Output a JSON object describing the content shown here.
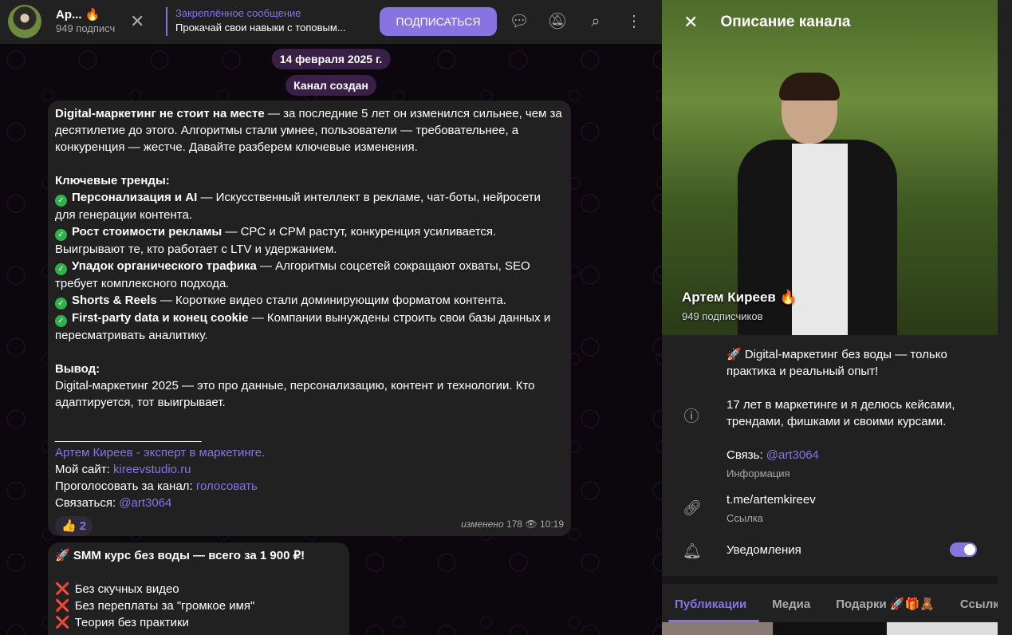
{
  "header": {
    "name": "Ар...",
    "name_emoji": "🔥",
    "subscribers": "949 подписч",
    "pinned_title": "Закреплённое сообщение",
    "pinned_text": "Прокачай свои навыки с топовым...",
    "subscribe": "ПОДПИСАТЬСЯ"
  },
  "chat": {
    "date": "14 февраля 2025 г.",
    "service": "Канал создан",
    "msg1": {
      "p1_bold": "Digital-маркетинг не стоит на месте",
      "p1": " — за последние 5 лет он изменился сильнее, чем за десятилетие до этого. Алгоритмы стали умнее, пользователи — требовательнее, а конкуренция — жестче. Давайте разберем ключевые изменения.",
      "trends_title": "Ключевые тренды:",
      "trends": [
        {
          "b": "Персонализация и AI",
          "t": " — Искусственный интеллект в рекламе, чат-боты, нейросети для генерации контента."
        },
        {
          "b": "Рост стоимости рекламы",
          "t": " — CPC и CPM растут, конкуренция усиливается. Выигрывают те, кто работает с LTV и удержанием."
        },
        {
          "b": "Упадок органического трафика",
          "t": " — Алгоритмы соцсетей сокращают охваты, SEO требует комплексного подхода."
        },
        {
          "b": "Shorts & Reels",
          "t": " — Короткие видео стали доминирующим форматом контента."
        },
        {
          "b": "First-party data и конец cookie",
          "t": " — Компании вынуждены строить свои базы данных и пересматривать аналитику."
        }
      ],
      "conclusion_title": "Вывод:",
      "conclusion": "Digital-маркетинг 2025 — это про данные, персонализацию, контент и технологии. Кто адаптируется, тот выигрывает.",
      "divider": "______________________",
      "author_link": "Артем Киреев - эксперт в маркетинге.",
      "site_label": "Мой сайт: ",
      "site_link": "kireevstudio.ru",
      "vote_label": "Проголосовать за канал: ",
      "vote_link": "голосовать",
      "contact_label": "Связаться: ",
      "contact_link": "@art3064",
      "reaction_emoji": "👍",
      "reaction_count": "2",
      "edited": "изменено",
      "views": "178",
      "time": "10:19"
    },
    "msg2": {
      "title": "🚀 SMM курс без воды — всего за 1 900 ₽!",
      "items": [
        "Без скучных видео",
        "Без переплаты за \"громкое имя\"",
        "Теория без практики"
      ]
    }
  },
  "panel": {
    "title": "Описание канала",
    "name": "Артем Киреев",
    "name_emoji": "🔥",
    "subscribers": "949 подписчиков",
    "desc1": "🚀 Digital-маркетинг без воды — только практика и реальный опыт!",
    "desc2": "17 лет в маркетинге и я делюсь кейсами, трендами, фишками и своими курсами.",
    "contact_label": "Связь: ",
    "contact_link": "@art3064",
    "info_label": "Информация",
    "link": "t.me/artemkireev",
    "link_label": "Ссылка",
    "notifications": "Уведомления",
    "notifications_on": true,
    "tabs": [
      "Публикации",
      "Медиа",
      "Подарки 🚀🎁🧸",
      "Ссылки"
    ]
  }
}
